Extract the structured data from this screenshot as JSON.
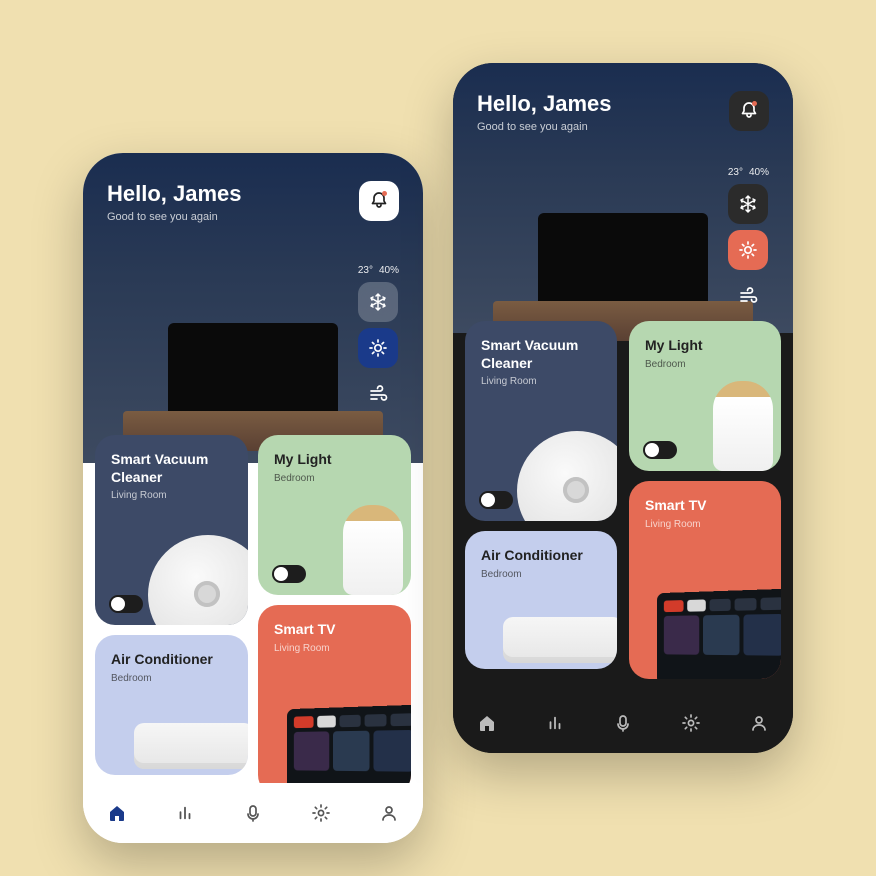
{
  "greeting": {
    "title": "Hello, James",
    "subtitle": "Good to see you again"
  },
  "climate": {
    "temp": "23°",
    "humidity": "40%"
  },
  "devices": {
    "vacuum": {
      "name": "Smart Vacuum Cleaner",
      "room": "Living Room"
    },
    "light": {
      "name": "My Light",
      "room": "Bedroom"
    },
    "ac": {
      "name": "Air Conditioner",
      "room": "Bedroom"
    },
    "tv": {
      "name": "Smart TV",
      "room": "Living Room"
    }
  },
  "icons": {
    "bell": "bell",
    "snowflake": "snowflake",
    "sun": "sun",
    "wind": "wind",
    "home": "home",
    "stats": "stats",
    "mic": "mic",
    "gear": "gear",
    "user": "user"
  },
  "colors": {
    "navy": "#3d4a67",
    "green": "#b6d7b0",
    "lilac": "#c4ceed",
    "coral": "#e56b54",
    "accent_light": "#1a3a8a",
    "accent_dark": "#e56b54"
  }
}
